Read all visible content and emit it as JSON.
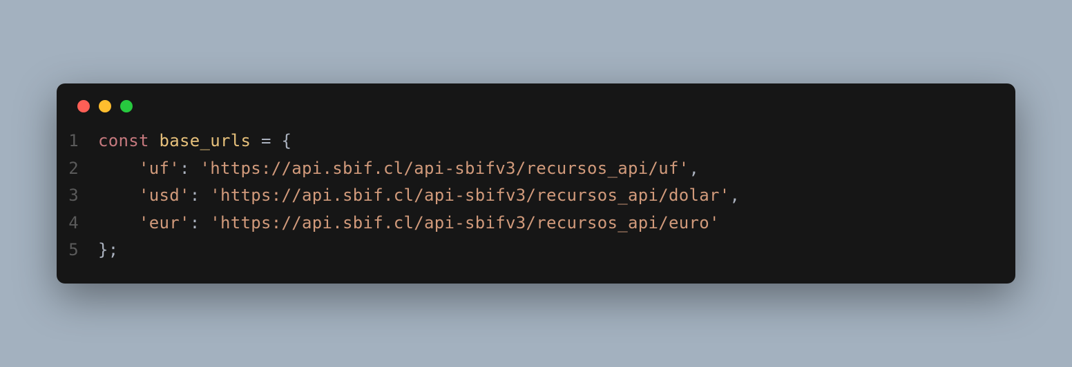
{
  "window": {
    "traffic_lights": [
      "red",
      "yellow",
      "green"
    ]
  },
  "code": {
    "lines": [
      {
        "number": "1",
        "tokens": [
          {
            "type": "keyword",
            "text": "const"
          },
          {
            "type": "space",
            "text": " "
          },
          {
            "type": "variable",
            "text": "base_urls"
          },
          {
            "type": "space",
            "text": " "
          },
          {
            "type": "operator",
            "text": "="
          },
          {
            "type": "space",
            "text": " "
          },
          {
            "type": "brace",
            "text": "{"
          }
        ]
      },
      {
        "number": "2",
        "tokens": [
          {
            "type": "indent",
            "text": "    "
          },
          {
            "type": "string",
            "text": "'uf'"
          },
          {
            "type": "punct",
            "text": ":"
          },
          {
            "type": "space",
            "text": " "
          },
          {
            "type": "string",
            "text": "'https://api.sbif.cl/api-sbifv3/recursos_api/uf'"
          },
          {
            "type": "punct",
            "text": ","
          }
        ]
      },
      {
        "number": "3",
        "tokens": [
          {
            "type": "indent",
            "text": "    "
          },
          {
            "type": "string",
            "text": "'usd'"
          },
          {
            "type": "punct",
            "text": ":"
          },
          {
            "type": "space",
            "text": " "
          },
          {
            "type": "string",
            "text": "'https://api.sbif.cl/api-sbifv3/recursos_api/dolar'"
          },
          {
            "type": "punct",
            "text": ","
          }
        ]
      },
      {
        "number": "4",
        "tokens": [
          {
            "type": "indent",
            "text": "    "
          },
          {
            "type": "string",
            "text": "'eur'"
          },
          {
            "type": "punct",
            "text": ":"
          },
          {
            "type": "space",
            "text": " "
          },
          {
            "type": "string",
            "text": "'https://api.sbif.cl/api-sbifv3/recursos_api/euro'"
          }
        ]
      },
      {
        "number": "5",
        "tokens": [
          {
            "type": "brace",
            "text": "}"
          },
          {
            "type": "punct",
            "text": ";"
          }
        ]
      }
    ]
  }
}
